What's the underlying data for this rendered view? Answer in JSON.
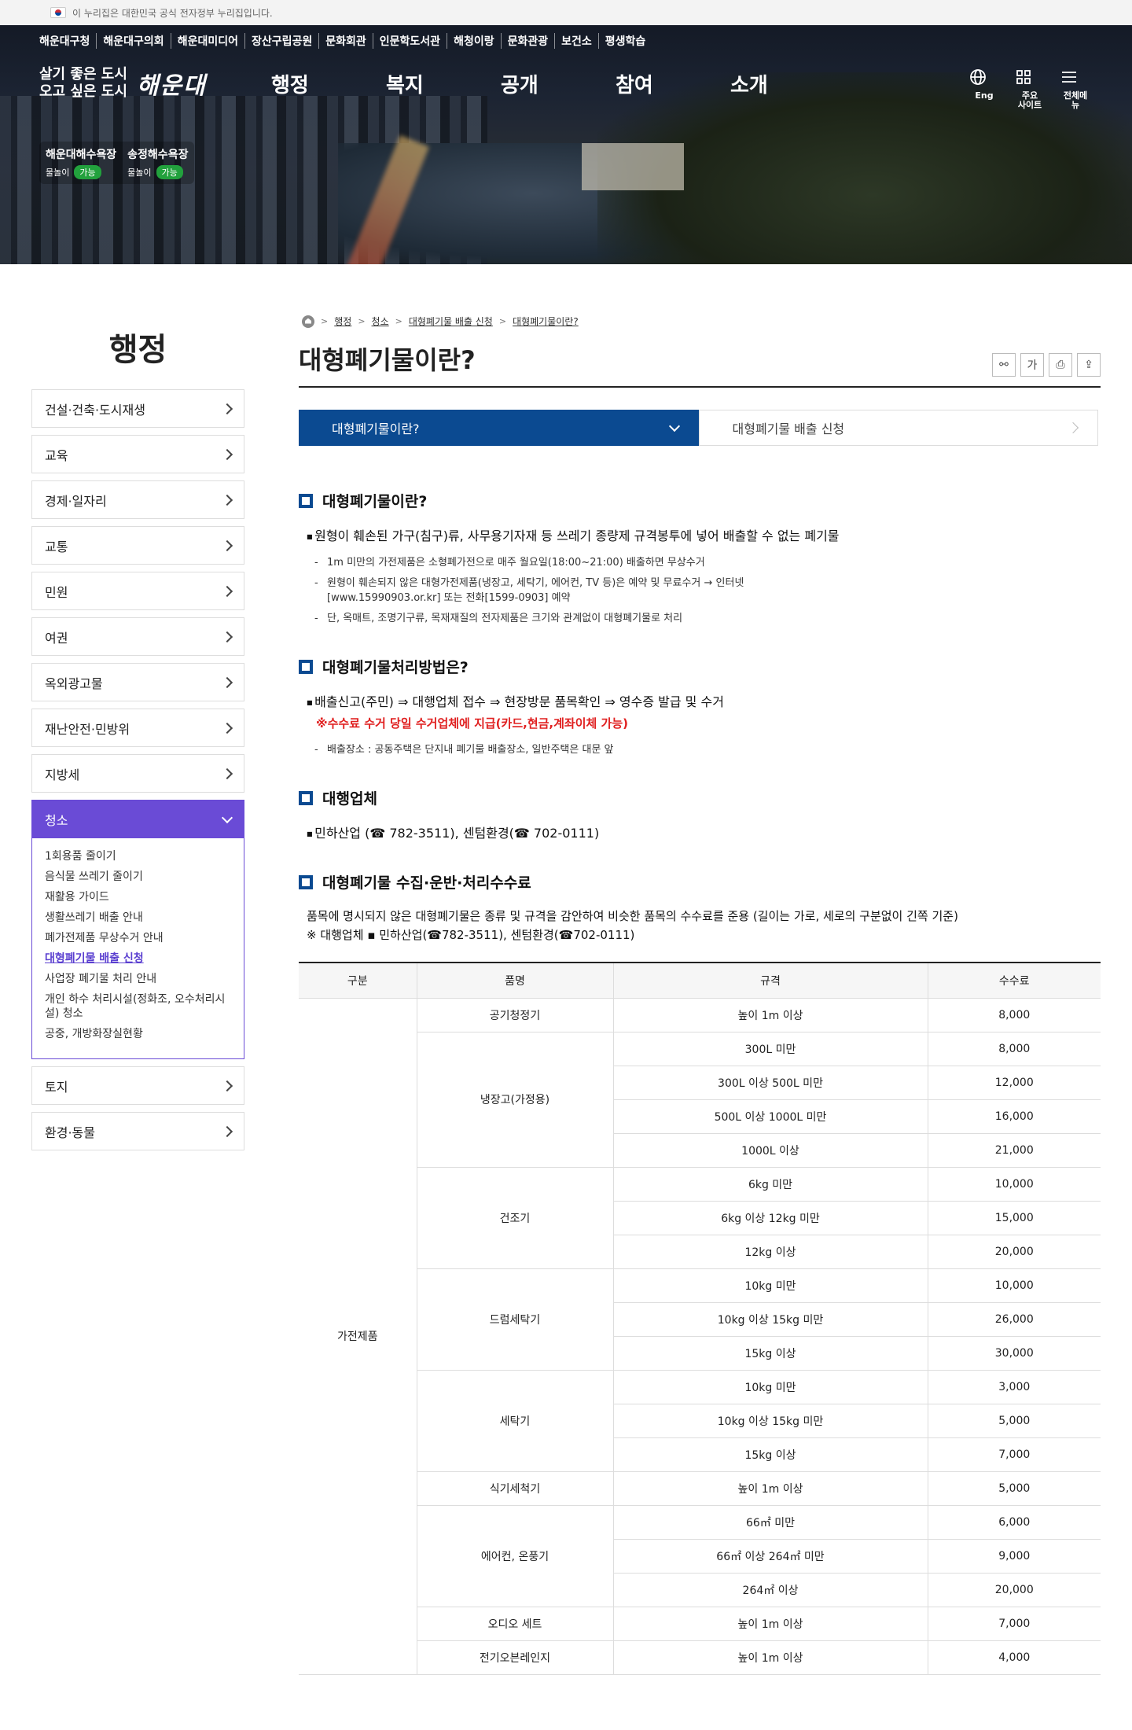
{
  "gov_bar": {
    "text": "이 누리집은 대한민국 공식 전자정부 누리집입니다."
  },
  "top_links": [
    "해운대구청",
    "해운대구의회",
    "해운대미디어",
    "장산구립공원",
    "문화회관",
    "인문학도서관",
    "해청이랑",
    "문화관광",
    "보건소",
    "평생학습"
  ],
  "brand": {
    "slogan_line1": "살기 좋은 도시",
    "slogan_line2": "오고 싶은 도시",
    "logo": "해운대"
  },
  "gnb": [
    "행정",
    "복지",
    "공개",
    "참여",
    "소개"
  ],
  "util": [
    {
      "label": "Eng",
      "icon": "globe-icon"
    },
    {
      "label": "주요\n사이트",
      "icon": "grid-icon"
    },
    {
      "label": "전체메뉴",
      "icon": "hamburger-icon"
    }
  ],
  "beaches": [
    {
      "name": "해운대해수욕장",
      "swim": "물놀이",
      "status": "가능"
    },
    {
      "name": "송정해수욕장",
      "swim": "물놀이",
      "status": "가능"
    }
  ],
  "sidebar": {
    "title": "행정",
    "items": [
      "건설·건축·도시재생",
      "교육",
      "경제·일자리",
      "교통",
      "민원",
      "여권",
      "옥외광고물",
      "재난안전·민방위",
      "지방세"
    ],
    "active": "청소",
    "sub": [
      "1회용품 줄이기",
      "음식물 쓰레기 줄이기",
      "재활용 가이드",
      "생활쓰레기 배출 안내",
      "폐가전제품 무상수거 안내",
      "대형폐기물 배출 신청",
      "사업장 폐기물 처리 안내",
      "개인 하수 처리시설(정화조, 오수처리시설) 청소",
      "공중, 개방화장실현황"
    ],
    "sub_current_index": 5,
    "after": [
      "토지",
      "환경·동물"
    ]
  },
  "breadcrumb": [
    "행정",
    "청소",
    "대형폐기물 배출 신청",
    "대형폐기물이란?"
  ],
  "page_title": "대형폐기물이란?",
  "tools": [
    {
      "icon": "link-icon",
      "glyph": "⚯"
    },
    {
      "icon": "font-size-icon",
      "glyph": "가"
    },
    {
      "icon": "print-icon",
      "glyph": "⎙"
    },
    {
      "icon": "share-icon",
      "glyph": "⇪"
    }
  ],
  "tabs": [
    "대형폐기물이란?",
    "대형폐기물 배출 신청"
  ],
  "s1": {
    "title": "대형폐기물이란?",
    "main": "원형이 훼손된 가구(침구)류, 사무용기자재 등 쓰레기 종량제 규격봉투에 넣어 배출할 수 없는 폐기물",
    "bullets": [
      "1m 미만의 가전제품은 소형폐가전으로 매주 월요일(18:00~21:00) 배출하면 무상수거",
      "원형이 훼손되지 않은 대형가전제품(냉장고, 세탁기, 에어컨, TV 등)은 예약 및 무료수거 → 인터넷 [www.15990903.or.kr] 또는 전화[1599-0903] 예약",
      "단, 옥매트, 조명기구류, 목재재질의 전자제품은 크기와 관계없이 대형폐기물로 처리"
    ]
  },
  "s2": {
    "title": "대형폐기물처리방법은?",
    "main": "배출신고(주민) ⇒ 대행업체 접수 ⇒ 현장방문 품목확인 ⇒ 영수증 발급 및 수거",
    "red": "※수수료 수거 당일 수거업체에 지급(카드,현금,계좌이체 가능)",
    "bullets": [
      "배출장소 : 공동주택은 단지내 폐기물 배출장소, 일반주택은 대문 앞"
    ]
  },
  "s3": {
    "title": "대행업체",
    "main": "민하산업 (☎ 782-3511), 센텀환경(☎ 702-0111)"
  },
  "s4": {
    "title": "대형폐기물 수집·운반·처리수수료",
    "intro1": "품목에 명시되지 않은 대형폐기물은 종류 및 규격을 감안하여 비슷한 품목의 수수료를 준용 (길이는 가로, 세로의 구분없이 긴쪽 기준)",
    "intro2": "※ 대행업체 ▪ 민하산업(☎782-3511), 센텀환경(☎702-0111)"
  },
  "table": {
    "headers": [
      "구분",
      "품명",
      "규격",
      "수수료"
    ],
    "group": "가전제품",
    "items": [
      {
        "name": "공기청정기",
        "rows": [
          [
            "높이 1m 이상",
            "8,000"
          ]
        ]
      },
      {
        "name": "냉장고(가정용)",
        "rows": [
          [
            "300L 미만",
            "8,000"
          ],
          [
            "300L 이상 500L 미만",
            "12,000"
          ],
          [
            "500L 이상 1000L 미만",
            "16,000"
          ],
          [
            "1000L 이상",
            "21,000"
          ]
        ]
      },
      {
        "name": "건조기",
        "rows": [
          [
            "6kg 미만",
            "10,000"
          ],
          [
            "6kg 이상 12kg 미만",
            "15,000"
          ],
          [
            "12kg 이상",
            "20,000"
          ]
        ]
      },
      {
        "name": "드럼세탁기",
        "rows": [
          [
            "10kg 미만",
            "10,000"
          ],
          [
            "10kg 이상 15kg 미만",
            "26,000"
          ],
          [
            "15kg 이상",
            "30,000"
          ]
        ]
      },
      {
        "name": "세탁기",
        "rows": [
          [
            "10kg 미만",
            "3,000"
          ],
          [
            "10kg 이상 15kg 미만",
            "5,000"
          ],
          [
            "15kg 이상",
            "7,000"
          ]
        ]
      },
      {
        "name": "식기세척기",
        "rows": [
          [
            "높이 1m 이상",
            "5,000"
          ]
        ]
      },
      {
        "name": "에어컨, 온풍기",
        "rows": [
          [
            "66㎡ 미만",
            "6,000"
          ],
          [
            "66㎡ 이상 264㎡ 미만",
            "9,000"
          ],
          [
            "264㎡ 이상",
            "20,000"
          ]
        ]
      },
      {
        "name": "오디오 세트",
        "rows": [
          [
            "높이 1m 이상",
            "7,000"
          ]
        ]
      },
      {
        "name": "전기오븐레인지",
        "rows": [
          [
            "높이 1m 이상",
            "4,000"
          ]
        ]
      }
    ]
  },
  "colors": {
    "accent": "#0b4a91",
    "side_active": "#6a4bd6",
    "red": "#e02020",
    "ok": "#22a13d"
  }
}
